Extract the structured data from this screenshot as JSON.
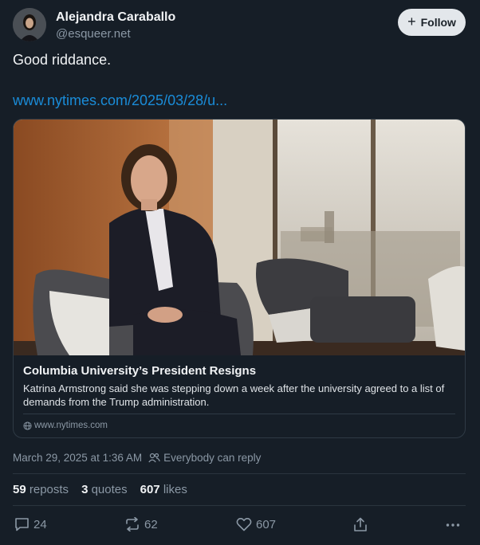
{
  "author": {
    "name": "Alejandra Caraballo",
    "handle": "@esqueer.net"
  },
  "follow_button": {
    "label": "Follow",
    "icon": "plus-icon"
  },
  "post": {
    "text": "Good riddance.",
    "link": "www.nytimes.com/2025/03/28/u..."
  },
  "link_card": {
    "title": "Columbia University’s President Resigns",
    "description": "Katrina Armstrong said she was stepping down a week after the university agreed to a list of demands from the Trump administration.",
    "domain": "www.nytimes.com",
    "domain_icon": "globe-icon"
  },
  "meta": {
    "timestamp": "March 29, 2025 at 1:36 AM",
    "reply_setting": "Everybody can reply",
    "reply_icon": "people-icon"
  },
  "stats": {
    "reposts_count": "59",
    "reposts_label": "reposts",
    "quotes_count": "3",
    "quotes_label": "quotes",
    "likes_count": "607",
    "likes_label": "likes"
  },
  "actions": {
    "reply_count": "24",
    "repost_count": "62",
    "like_count": "607"
  },
  "colors": {
    "background": "#161e27",
    "link": "#1a8cd8",
    "muted": "#8b98a5",
    "follow_bg": "#e3e7eb"
  }
}
